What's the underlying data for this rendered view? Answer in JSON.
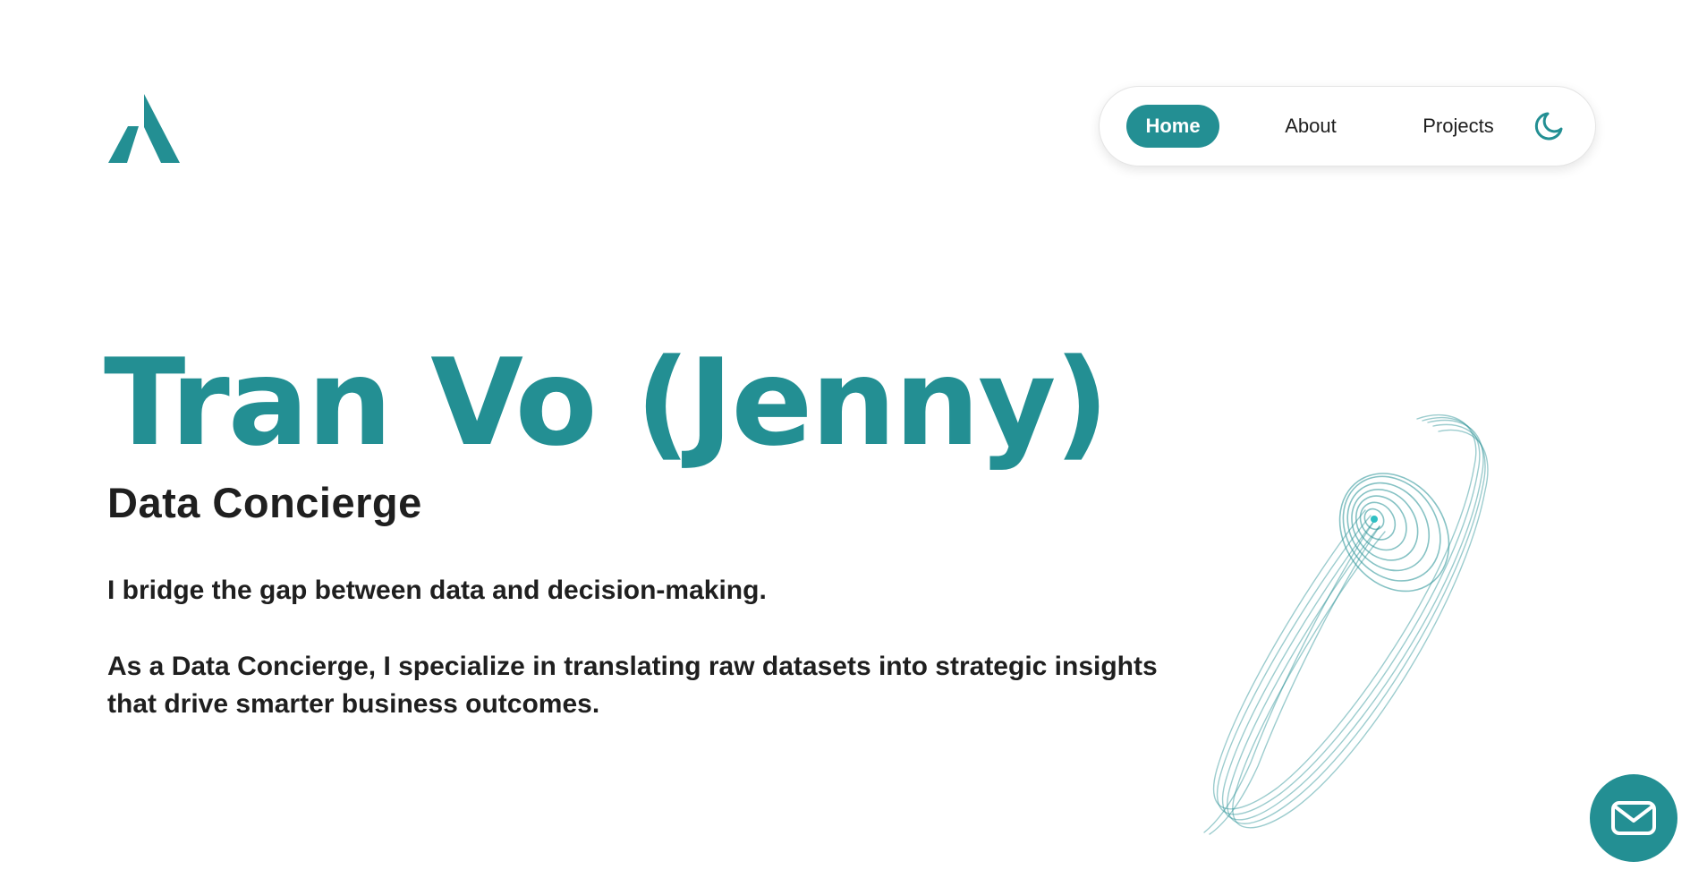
{
  "nav": {
    "items": [
      {
        "label": "Home",
        "active": true
      },
      {
        "label": "About",
        "active": false
      },
      {
        "label": "Projects",
        "active": false
      }
    ],
    "theme_toggle_icon": "moon-icon"
  },
  "hero": {
    "name": "Tran Vo (Jenny)",
    "role": "Data Concierge",
    "tagline": "I bridge the gap between data and decision-making.",
    "description": "As a Data Concierge, I specialize in translating raw datasets into strategic insights that drive smarter business outcomes."
  },
  "logo_icon": "a-logo-icon",
  "decoration_icon": "spiral-icon",
  "contact_icon": "mail-icon",
  "colors": {
    "accent": "#238f93",
    "text": "#1f1f1f",
    "background": "#ffffff"
  }
}
